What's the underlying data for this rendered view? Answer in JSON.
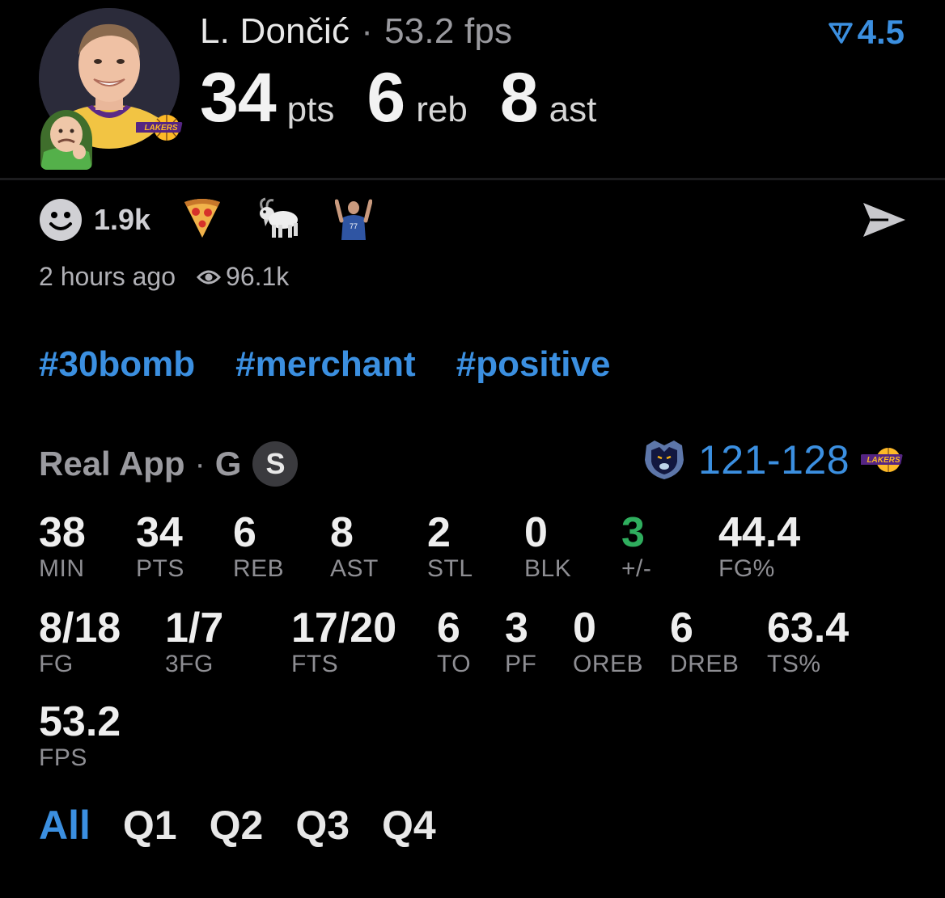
{
  "header": {
    "player_name": "L. Dončić",
    "fps_label": "53.2 fps",
    "rating": "4.5",
    "rating_icon": "filter-arrow-icon",
    "statline": [
      {
        "value": "34",
        "unit": "pts"
      },
      {
        "value": "6",
        "unit": "reb"
      },
      {
        "value": "8",
        "unit": "ast"
      }
    ]
  },
  "reactions": {
    "count": "1.9k",
    "emojis": [
      "pizza-icon",
      "goat-icon",
      "player-photo-icon"
    ]
  },
  "meta": {
    "time": "2 hours ago",
    "views": "96.1k"
  },
  "tags": [
    "#30bomb",
    "#merchant",
    "#positive"
  ],
  "boxscore": {
    "source": "Real App",
    "position": "G",
    "badge": "S",
    "score": "121-128",
    "row1": [
      {
        "value": "38",
        "label": "MIN"
      },
      {
        "value": "34",
        "label": "PTS"
      },
      {
        "value": "6",
        "label": "REB"
      },
      {
        "value": "8",
        "label": "AST"
      },
      {
        "value": "2",
        "label": "STL"
      },
      {
        "value": "0",
        "label": "BLK"
      },
      {
        "value": "3",
        "label": "+/-"
      },
      {
        "value": "44.4",
        "label": "FG%"
      }
    ],
    "row2": [
      {
        "value": "8/18",
        "label": "FG"
      },
      {
        "value": "1/7",
        "label": "3FG"
      },
      {
        "value": "17/20",
        "label": "FTS"
      },
      {
        "value": "6",
        "label": "TO"
      },
      {
        "value": "3",
        "label": "PF"
      },
      {
        "value": "0",
        "label": "OREB"
      },
      {
        "value": "6",
        "label": "DREB"
      },
      {
        "value": "63.4",
        "label": "TS%"
      }
    ],
    "row3": [
      {
        "value": "53.2",
        "label": "FPS"
      }
    ],
    "quarters": [
      "All",
      "Q1",
      "Q2",
      "Q3",
      "Q4"
    ],
    "active_quarter": "All"
  },
  "colors": {
    "accent": "#3b8fe0",
    "positive": "#2fae5e",
    "lakers_purple": "#552583",
    "lakers_gold": "#FDB927"
  }
}
